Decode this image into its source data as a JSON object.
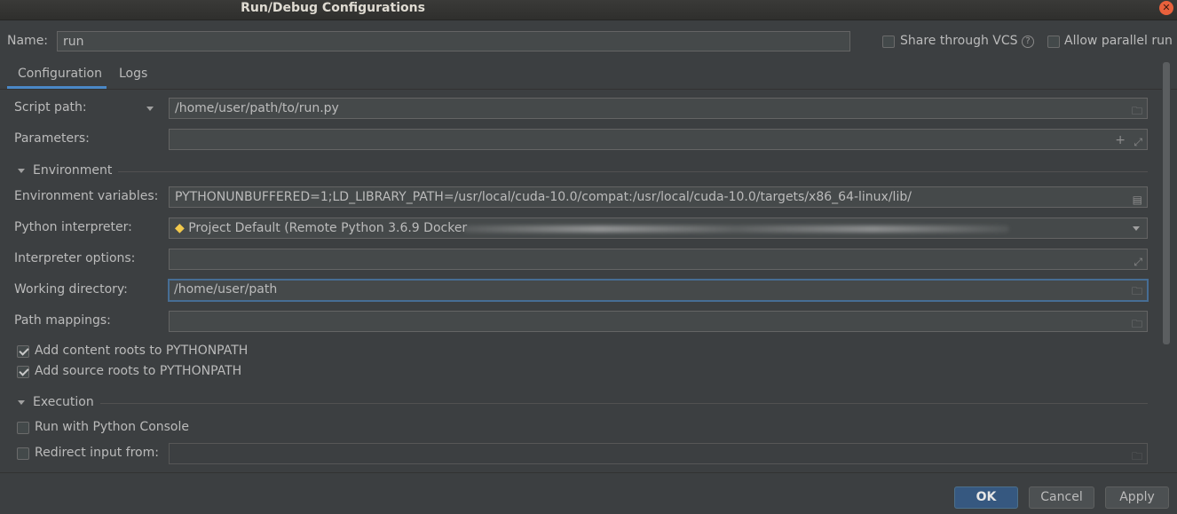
{
  "window": {
    "title": "Run/Debug Configurations"
  },
  "name_field": {
    "label": "Name:",
    "value": "run"
  },
  "options": {
    "share_vcs": {
      "label": "Share through VCS",
      "checked": false
    },
    "allow_parallel": {
      "label": "Allow parallel run",
      "checked": false
    }
  },
  "tabs": [
    {
      "label": "Configuration",
      "active": true
    },
    {
      "label": "Logs",
      "active": false
    }
  ],
  "form": {
    "script_path": {
      "label": "Script path:",
      "value": "/home/user/path/to/run.py"
    },
    "parameters": {
      "label": "Parameters:",
      "value": ""
    },
    "environment_section": {
      "label": "Environment"
    },
    "env_vars": {
      "label": "Environment variables:",
      "value": "PYTHONUNBUFFERED=1;LD_LIBRARY_PATH=/usr/local/cuda-10.0/compat:/usr/local/cuda-10.0/targets/x86_64-linux/lib/"
    },
    "interpreter": {
      "label": "Python interpreter:",
      "value": "Project Default (Remote Python 3.6.9 Docker"
    },
    "interpreter_options": {
      "label": "Interpreter options:",
      "value": ""
    },
    "working_dir": {
      "label": "Working directory:",
      "value": "/home/user/path"
    },
    "path_mappings": {
      "label": "Path mappings:",
      "value": ""
    },
    "content_roots": {
      "label": "Add content roots to PYTHONPATH",
      "checked": true
    },
    "source_roots": {
      "label": "Add source roots to PYTHONPATH",
      "checked": true
    },
    "execution_section": {
      "label": "Execution"
    },
    "python_console": {
      "label": "Run with Python Console",
      "checked": false
    },
    "redirect_input": {
      "label": "Redirect input from:",
      "checked": false,
      "value": ""
    }
  },
  "buttons": {
    "ok": "OK",
    "cancel": "Cancel",
    "apply": "Apply"
  },
  "colors": {
    "background": "#3c3f41",
    "field": "#45494a",
    "accent": "#4a88c7",
    "primary_button": "#365880"
  }
}
